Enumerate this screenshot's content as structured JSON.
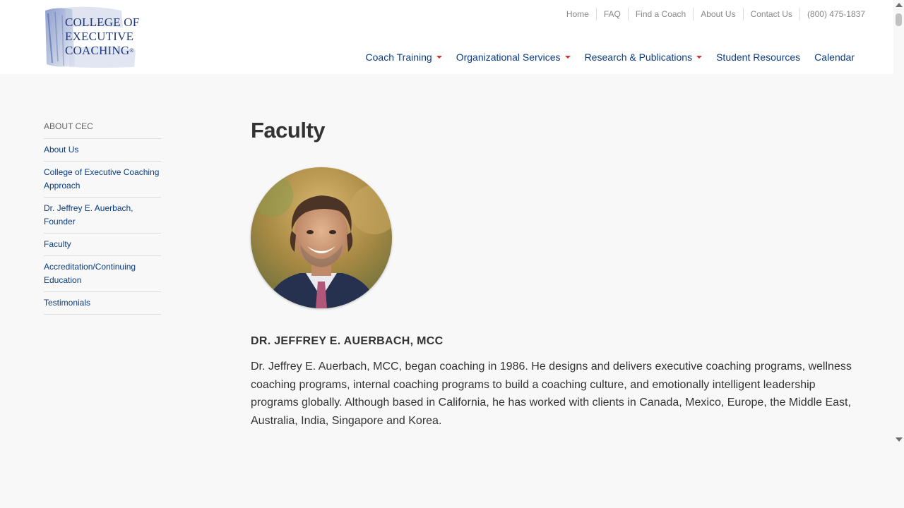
{
  "header": {
    "logo": {
      "line1": "COLLEGE OF",
      "line2": "EXECUTIVE",
      "line3": "COACHING",
      "reg": "®"
    },
    "top_links": [
      "Home",
      "FAQ",
      "Find a Coach",
      "About Us",
      "Contact Us",
      "(800) 475-1837"
    ],
    "main_nav": [
      {
        "label": "Coach Training",
        "dropdown": true
      },
      {
        "label": "Organizational Services",
        "dropdown": true
      },
      {
        "label": "Research & Publications",
        "dropdown": true
      },
      {
        "label": "Student Resources",
        "dropdown": false
      },
      {
        "label": "Calendar",
        "dropdown": false
      }
    ]
  },
  "sidebar": {
    "heading": "ABOUT CEC",
    "items": [
      "About Us",
      "College of Executive Coaching Approach",
      "Dr. Jeffrey E. Auerbach, Founder",
      "Faculty",
      "Accreditation/Continuing Education",
      "Testimonials"
    ]
  },
  "main": {
    "title": "Faculty",
    "person": {
      "name": "DR. JEFFREY E. AUERBACH, MCC",
      "bio": "Dr. Jeffrey E. Auerbach, MCC, began coaching in 1986. He designs and delivers executive coaching programs, wellness coaching programs, internal coaching programs to build a coaching culture, and emotionally intelligent leadership programs globally. Although based in California, he has worked with clients in Canada, Mexico, Europe, the Middle East, Australia, India, Singapore and Korea."
    }
  },
  "colors": {
    "link": "#0a3c82",
    "caret": "#cc3333",
    "top_link": "#888888",
    "page_bg": "#f8f8f8"
  },
  "icons": {
    "caret": "caret-down-icon",
    "scroll_up": "scroll-up-arrow-icon",
    "scroll_down": "scroll-down-arrow-icon"
  }
}
